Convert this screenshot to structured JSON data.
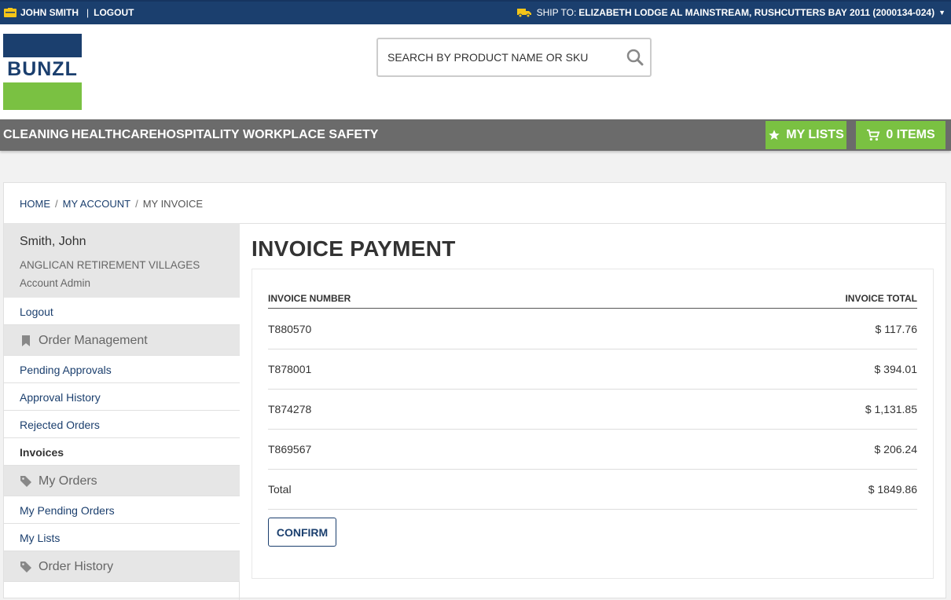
{
  "topbar": {
    "user_name": "JOHN SMITH",
    "separator": "|",
    "logout": "LOGOUT",
    "ship_to_label": "SHIP TO:",
    "ship_to_value": "ELIZABETH LODGE AL MAINSTREAM, RUSHCUTTERS BAY 2011 (2000134-024)",
    "icons": {
      "user": "id-card-icon",
      "ship": "truck-icon",
      "dropdown": "caret-down-icon"
    }
  },
  "logo": {
    "text": "BUNZL"
  },
  "search": {
    "placeholder": "SEARCH BY PRODUCT NAME OR SKU",
    "icon": "search-icon"
  },
  "nav": {
    "items": [
      "CLEANING",
      "HEALTHCARE",
      "HOSPITALITY",
      "WORKPLACE SAFETY"
    ],
    "my_lists": "MY LISTS",
    "cart": "0 ITEMS"
  },
  "breadcrumb": {
    "items": [
      "HOME",
      "MY ACCOUNT",
      "MY INVOICE"
    ],
    "separator": "/"
  },
  "sidebar": {
    "profile": {
      "name": "Smith, John",
      "company": "ANGLICAN RETIREMENT VILLAGES",
      "role": "Account Admin"
    },
    "logout": "Logout",
    "sections": [
      {
        "title": "Order Management",
        "icon": "bookmark-icon",
        "links": [
          "Pending Approvals",
          "Approval History",
          "Rejected Orders",
          "Invoices"
        ]
      },
      {
        "title": "My Orders",
        "icon": "tag-icon",
        "links": [
          "My Pending Orders",
          "My Lists"
        ]
      },
      {
        "title": "Order History",
        "icon": "tag-icon",
        "links": []
      }
    ],
    "active_link": "Invoices"
  },
  "main": {
    "title": "INVOICE PAYMENT",
    "columns": [
      "INVOICE NUMBER",
      "INVOICE TOTAL"
    ],
    "rows": [
      {
        "number": "T880570",
        "total": "$ 117.76"
      },
      {
        "number": "T878001",
        "total": "$ 394.01"
      },
      {
        "number": "T874278",
        "total": "$ 1,131.85"
      },
      {
        "number": "T869567",
        "total": "$ 206.24"
      }
    ],
    "total_label": "Total",
    "total_value": "$ 1849.86",
    "confirm": "CONFIRM"
  },
  "colors": {
    "brand_blue": "#1b3f6e",
    "brand_green": "#7ac142",
    "nav_gray": "#6b6b6b"
  }
}
